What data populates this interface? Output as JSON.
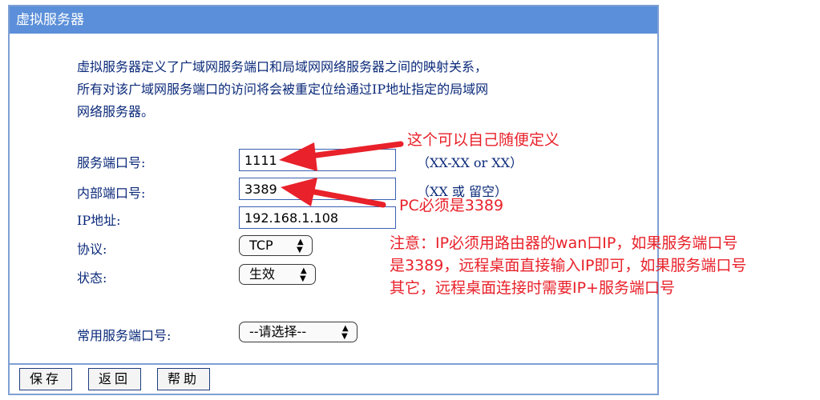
{
  "window": {
    "title": "虚拟服务器"
  },
  "description": {
    "line1": "虚拟服务器定义了广域网服务端口和局域网网络服务器之间的映射关系，",
    "line2": "所有对该广域网服务端口的访问将会被重定位给通过IP地址指定的局域网",
    "line3": "网络服务器。"
  },
  "form": {
    "service_port": {
      "label": "服务端口号:",
      "value": "1111",
      "hint": "（XX-XX or XX）"
    },
    "internal_port": {
      "label": "内部端口号:",
      "value": "3389",
      "hint": "（XX 或 留空）"
    },
    "ip_address": {
      "label": "IP地址:",
      "value": "192.168.1.108"
    },
    "protocol": {
      "label": "协议:",
      "selected": "TCP"
    },
    "status": {
      "label": "状态:",
      "selected": "生效"
    },
    "common_ports": {
      "label": "常用服务端口号:",
      "selected": "--请选择--"
    }
  },
  "buttons": {
    "save": "保存",
    "back": "返回",
    "help": "帮助"
  },
  "annotations": {
    "note1": "这个可以自己随便定义",
    "note2": "PC必须是3389",
    "note3_line1": "注意：IP必须用路由器的wan口IP，如果服务端口号",
    "note3_line2": "是3389，远程桌面直接输入IP即可，如果服务端口号",
    "note3_line3": "其它，远程桌面连接时需要IP+服务端口号",
    "color": "#e8212a"
  },
  "colors": {
    "titlebar": "#5b8fd9",
    "border": "#7ea0d4",
    "text": "#0b2a7a"
  }
}
